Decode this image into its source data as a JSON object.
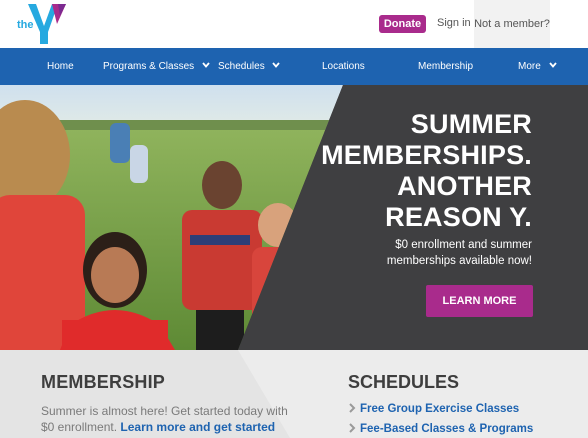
{
  "header": {
    "logo_label": "the Y logo",
    "donate_label": "Donate",
    "signin_label": "Sign in",
    "not_member_label": "Not a member?"
  },
  "nav": {
    "items": [
      {
        "label": "Home",
        "has_dropdown": false
      },
      {
        "label": "Programs & Classes",
        "has_dropdown": true
      },
      {
        "label": "Schedules",
        "has_dropdown": true
      },
      {
        "label": "Locations",
        "has_dropdown": false
      },
      {
        "label": "Membership",
        "has_dropdown": false
      },
      {
        "label": "More",
        "has_dropdown": true
      }
    ]
  },
  "hero": {
    "headline_lines": [
      "SUMMER",
      "MEMBERSHIPS.",
      "ANOTHER",
      "REASON Y."
    ],
    "subhead_lines": [
      "$0 enrollment and summer",
      "memberships available now!"
    ],
    "cta_label": "LEARN MORE"
  },
  "membership": {
    "title": "MEMBERSHIP",
    "text_line1": "Summer is almost here! Get started today with",
    "text_line2_prefix": "$0 enrollment.",
    "link_label": "Learn more and get started"
  },
  "schedules": {
    "title": "SCHEDULES",
    "links": [
      "Free Group Exercise Classes",
      "Fee-Based Classes & Programs"
    ]
  },
  "colors": {
    "nav_blue": "#1e63b0",
    "brand_purple": "#a92b8c",
    "logo_cyan": "#26a9e0",
    "hero_dark": "#3f3f41"
  }
}
